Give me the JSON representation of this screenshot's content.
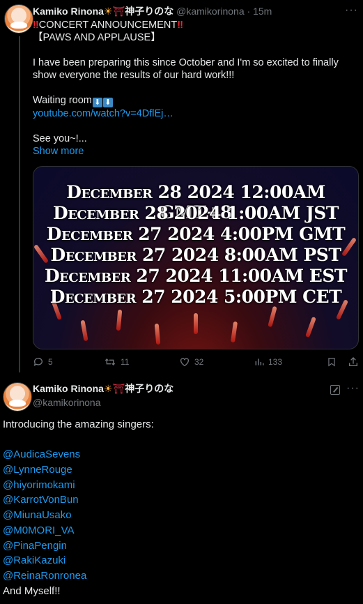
{
  "tweet1": {
    "name": "Kamiko Rinona",
    "name_jp": "神子りのな",
    "handle": "@kamikorinona",
    "sep": "·",
    "time": "15m",
    "line1": "CONCERT ANNOUNCEMENT",
    "line2": "【PAWS AND APPLAUSE】",
    "para": "I have been preparing this since October and I'm so excited to finally show everyone the results of our hard work!!!",
    "waiting": "Waiting room",
    "link": "youtube.com/watch?v=4DflEj…",
    "see_you": "See you~!...",
    "show_more": "Show more",
    "media": {
      "lines": [
        "December 28 2024 12:00AM GMT+8",
        "December 28 2024 1:00AM JST",
        "December 27 2024 4:00PM GMT",
        "December 27 2024 8:00AM PST",
        "December 27 2024 11:00AM EST",
        "December 27 2024 5:00PM CET"
      ]
    },
    "actions": {
      "replies": "5",
      "reposts": "11",
      "likes": "32",
      "views": "133"
    }
  },
  "tweet2": {
    "name": "Kamiko Rinona",
    "name_jp": "神子りのな",
    "handle": "@kamikorinona",
    "intro": "Introducing the amazing singers:",
    "mentions": [
      "@AudicaSevens",
      "@LynneRouge",
      "@hiyorimokami",
      "@KarrotVonBun",
      "@MiunaUsako",
      "@M0MORI_VA",
      "@PinaPengin",
      "@RakiKazuki",
      "@ReinaRonronea"
    ],
    "closing": "And Myself!!"
  },
  "icons": [
    "avatar",
    "more-icon",
    "reply-icon",
    "repost-icon",
    "like-icon",
    "views-icon",
    "bookmark-icon",
    "share-icon",
    "grok-icon",
    "sun-emoji",
    "torii-emoji",
    "down-arrow-emoji"
  ],
  "colors": {
    "link": "#1d9bf0",
    "muted": "#71767b",
    "bg": "#000000"
  }
}
